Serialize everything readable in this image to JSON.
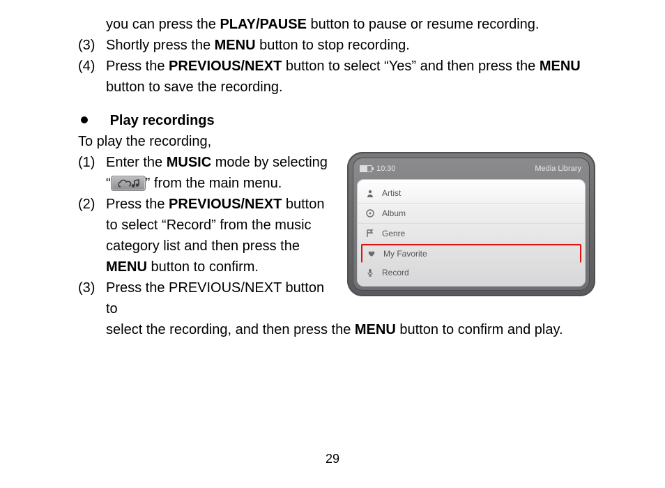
{
  "page_number": "29",
  "top_fragment": {
    "pre": "you can press the ",
    "bold": "PLAY/PAUSE",
    "post": " button to pause or resume recording."
  },
  "step3": {
    "num": "(3)",
    "pre": "Shortly press the ",
    "bold": "MENU",
    "post": " button to stop recording."
  },
  "step4": {
    "num": "(4)",
    "pre": "Press the ",
    "b1": "PREVIOUS/NEXT",
    "mid": " button to select “Yes” and then press the ",
    "b2": "MENU",
    "post": " button to save the recording."
  },
  "section_title": "Play recordings",
  "intro": "To play the recording,",
  "p1": {
    "num": "(1)",
    "pre": "Enter the ",
    "b1": "MUSIC",
    "mid": " mode by selecting “",
    "post": "” from the main menu."
  },
  "p2": {
    "num": "(2)",
    "pre": "Press the ",
    "b1": "PREVIOUS/NEXT",
    "mid": " button to select “Record” from the music category list and then press the ",
    "b2": "MENU",
    "post": " button to confirm."
  },
  "p3a": {
    "num": "(3)",
    "text": "Press the PREVIOUS/NEXT button to"
  },
  "p3b": {
    "pre": "select the recording, and then press the ",
    "b1": "MENU",
    "post": " button to confirm and play."
  },
  "device": {
    "time": "10:30",
    "title": "Media Library",
    "items": [
      "Artist",
      "Album",
      "Genre",
      "My Favorite",
      "Record"
    ],
    "highlighted_index": 3,
    "icons": [
      "person-icon",
      "disc-icon",
      "flag-icon",
      "heart-icon",
      "mic-icon"
    ]
  }
}
